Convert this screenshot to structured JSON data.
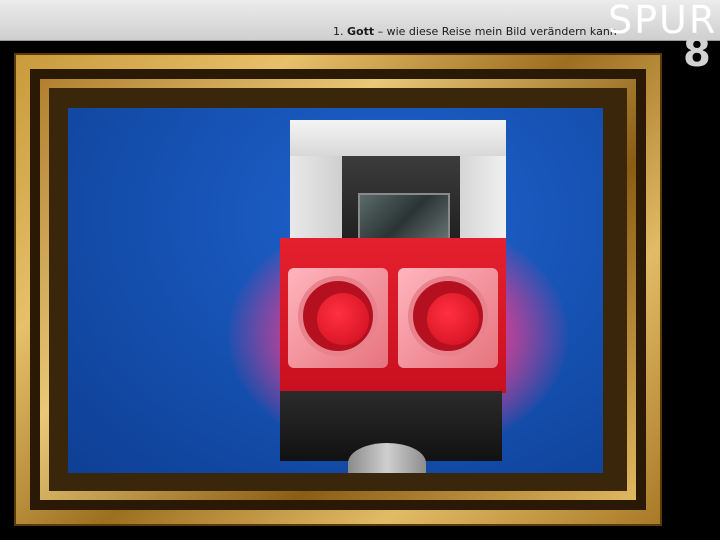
{
  "header": {
    "chapter_number": "1.",
    "chapter_title": "Gott",
    "separator": "–",
    "subtitle": "wie diese Reise mein Bild verändern kann"
  },
  "logo": {
    "word": "SPUR",
    "number": "8"
  },
  "colors": {
    "header_bg": "#d9d9d9",
    "frame_gold": "#c89a3a",
    "sky_blue": "#1a58c0",
    "signal_red": "#d8101f",
    "glow_pink": "#f0508c"
  }
}
